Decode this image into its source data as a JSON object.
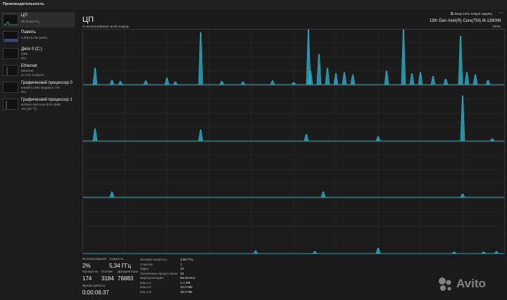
{
  "app": {
    "title": "Производительность"
  },
  "sidebar": {
    "items": [
      {
        "name": "ЦП",
        "sub1": "2% 5,34 ГГц",
        "sub2": "",
        "sub3": "",
        "active": true
      },
      {
        "name": "Память",
        "sub1": "4,5/31,8 ГБ (14%)",
        "sub2": "",
        "sub3": "",
        "active": false
      },
      {
        "name": "Диск 0 (C:)",
        "sub1": "SSD",
        "sub2": "0%",
        "sub3": "",
        "active": false
      },
      {
        "name": "Ethernet",
        "sub1": "Ethernet",
        "sub2": "О: 0 П: 0 кбит/с",
        "sub3": "",
        "active": false
      },
      {
        "name": "Графический процессор 0",
        "sub1": "Intel(R) UHD Graphics 770",
        "sub2": "0%",
        "sub3": "",
        "active": false
      },
      {
        "name": "Графический процессор 1",
        "sub1": "NVIDIA GeForce RTX 4090",
        "sub2": "1% (42 °C)",
        "sub3": "",
        "active": false
      }
    ]
  },
  "main": {
    "title": "ЦП",
    "run_task_label": "Запустить новую задачу",
    "more_label": "···",
    "cpu_model": "13th Gen Intel(R) Core(TM) i9-13900K",
    "util_label": "% использования за 60 секунд",
    "max_label": "100%"
  },
  "stats": {
    "usage_label": "Использование",
    "usage_value": "2%",
    "speed_label": "Скорость",
    "speed_value": "5,34 ГГц",
    "processes_label": "Процессы",
    "processes_value": "174",
    "threads_label": "Потоки",
    "threads_value": "3184",
    "handles_label": "Дескрипторы",
    "handles_value": "76883",
    "uptime_label": "Время работы",
    "uptime_value": "0:00:06:37"
  },
  "details": [
    {
      "label": "Базовая скорость:",
      "value": "3,00 ГГц"
    },
    {
      "label": "Сокетов:",
      "value": "1"
    },
    {
      "label": "Ядра:",
      "value": "24"
    },
    {
      "label": "Логических процессоров:",
      "value": "32"
    },
    {
      "label": "Виртуализация:",
      "value": "Включено"
    },
    {
      "label": "Кэш L1:",
      "value": "2,1 МБ"
    },
    {
      "label": "Кэш L2:",
      "value": "32,0 МБ"
    },
    {
      "label": "Кэш L3:",
      "value": "36,0 МБ"
    }
  ],
  "watermark": {
    "text": "Avito"
  },
  "colors": {
    "accent": "#2fb6cf",
    "grid": "#2c2c2c",
    "border": "#3d3d3d",
    "memory": "#4f7dd9",
    "gpu": "#b35fd6"
  },
  "chart_data": {
    "type": "area",
    "grid": true,
    "ylim": [
      0,
      100
    ],
    "panes": [
      {
        "spikes": [
          [
            0.03,
            30
          ],
          [
            0.07,
            8
          ],
          [
            0.09,
            6
          ],
          [
            0.15,
            7
          ],
          [
            0.2,
            12
          ],
          [
            0.22,
            5
          ],
          [
            0.28,
            95
          ],
          [
            0.33,
            6
          ],
          [
            0.38,
            5
          ],
          [
            0.45,
            7
          ],
          [
            0.5,
            4
          ],
          [
            0.535,
            100
          ],
          [
            0.54,
            25
          ],
          [
            0.56,
            55
          ],
          [
            0.58,
            30
          ],
          [
            0.6,
            20
          ],
          [
            0.62,
            22
          ],
          [
            0.64,
            18
          ],
          [
            0.72,
            25
          ],
          [
            0.76,
            100
          ],
          [
            0.78,
            20
          ],
          [
            0.8,
            22
          ],
          [
            0.83,
            15
          ],
          [
            0.86,
            10
          ],
          [
            0.895,
            88
          ],
          [
            0.91,
            22
          ],
          [
            0.93,
            18
          ],
          [
            0.96,
            8
          ]
        ]
      },
      {
        "spikes": [
          [
            0.03,
            22
          ],
          [
            0.28,
            20
          ],
          [
            0.53,
            12
          ],
          [
            0.7,
            8
          ],
          [
            0.9,
            82
          ],
          [
            0.97,
            4
          ]
        ]
      },
      {
        "spikes": [
          [
            0.07,
            10
          ],
          [
            0.57,
            10
          ],
          [
            0.9,
            6
          ]
        ]
      },
      {
        "spikes": [
          [
            0.41,
            5
          ],
          [
            0.55,
            4
          ],
          [
            0.7,
            10
          ],
          [
            0.88,
            3
          ],
          [
            0.95,
            3
          ],
          [
            0.98,
            4
          ]
        ]
      }
    ]
  }
}
